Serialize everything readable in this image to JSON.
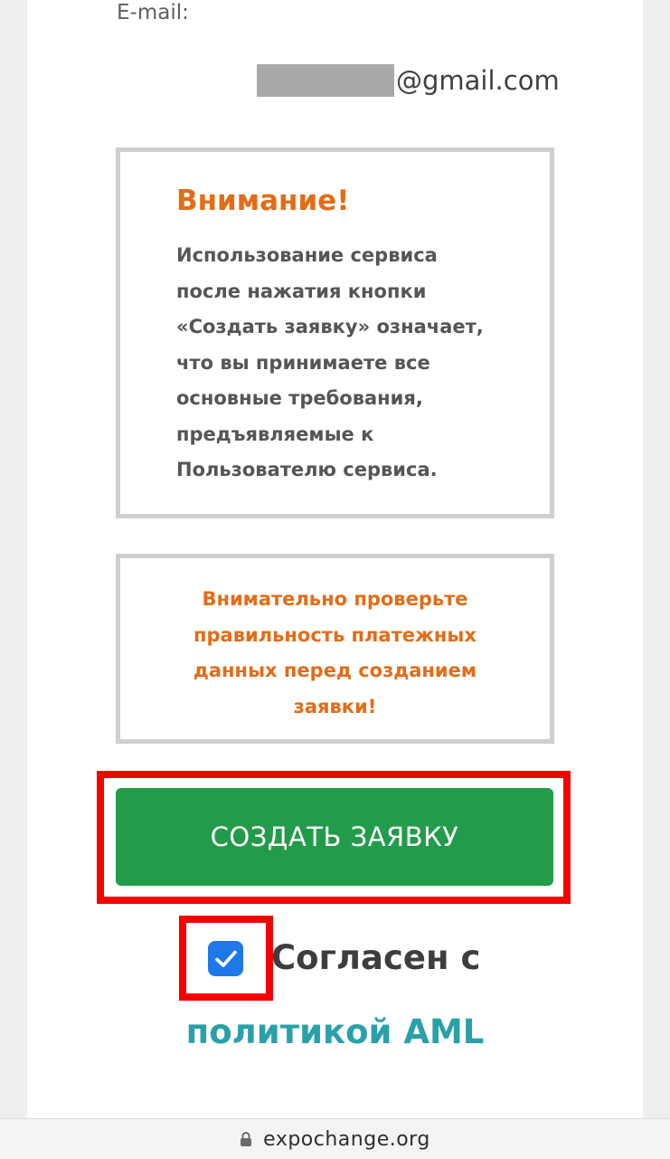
{
  "form": {
    "email_label": "E-mail:",
    "email_domain": "@gmail.com"
  },
  "attention": {
    "title": "Внимание!",
    "text": "Использование сервиса\nпосле нажатия кнопки\n«Создать заявку» означает,\nчто вы принимаете все\nосновные требования,\nпредъявляемые к\nПользователю сервиса."
  },
  "check_notice": {
    "text": "Внимательно проверьте\nправильность платежных\nданных перед созданием\nзаявки!"
  },
  "submit_button": {
    "label": "СОЗДАТЬ ЗАЯВКУ"
  },
  "agreement": {
    "checked": true,
    "text": "Согласен с",
    "link_text": "политикой AML"
  },
  "browser": {
    "url": "expochange.org"
  },
  "colors": {
    "accent_orange": "#e36c17",
    "button_green": "#229c4a",
    "checkbox_blue": "#1f78e8",
    "link_teal": "#2aa0a8",
    "highlight_red": "#f70000"
  },
  "icons": {
    "checkbox": "checkmark-icon",
    "url_bar": "lock-icon"
  }
}
